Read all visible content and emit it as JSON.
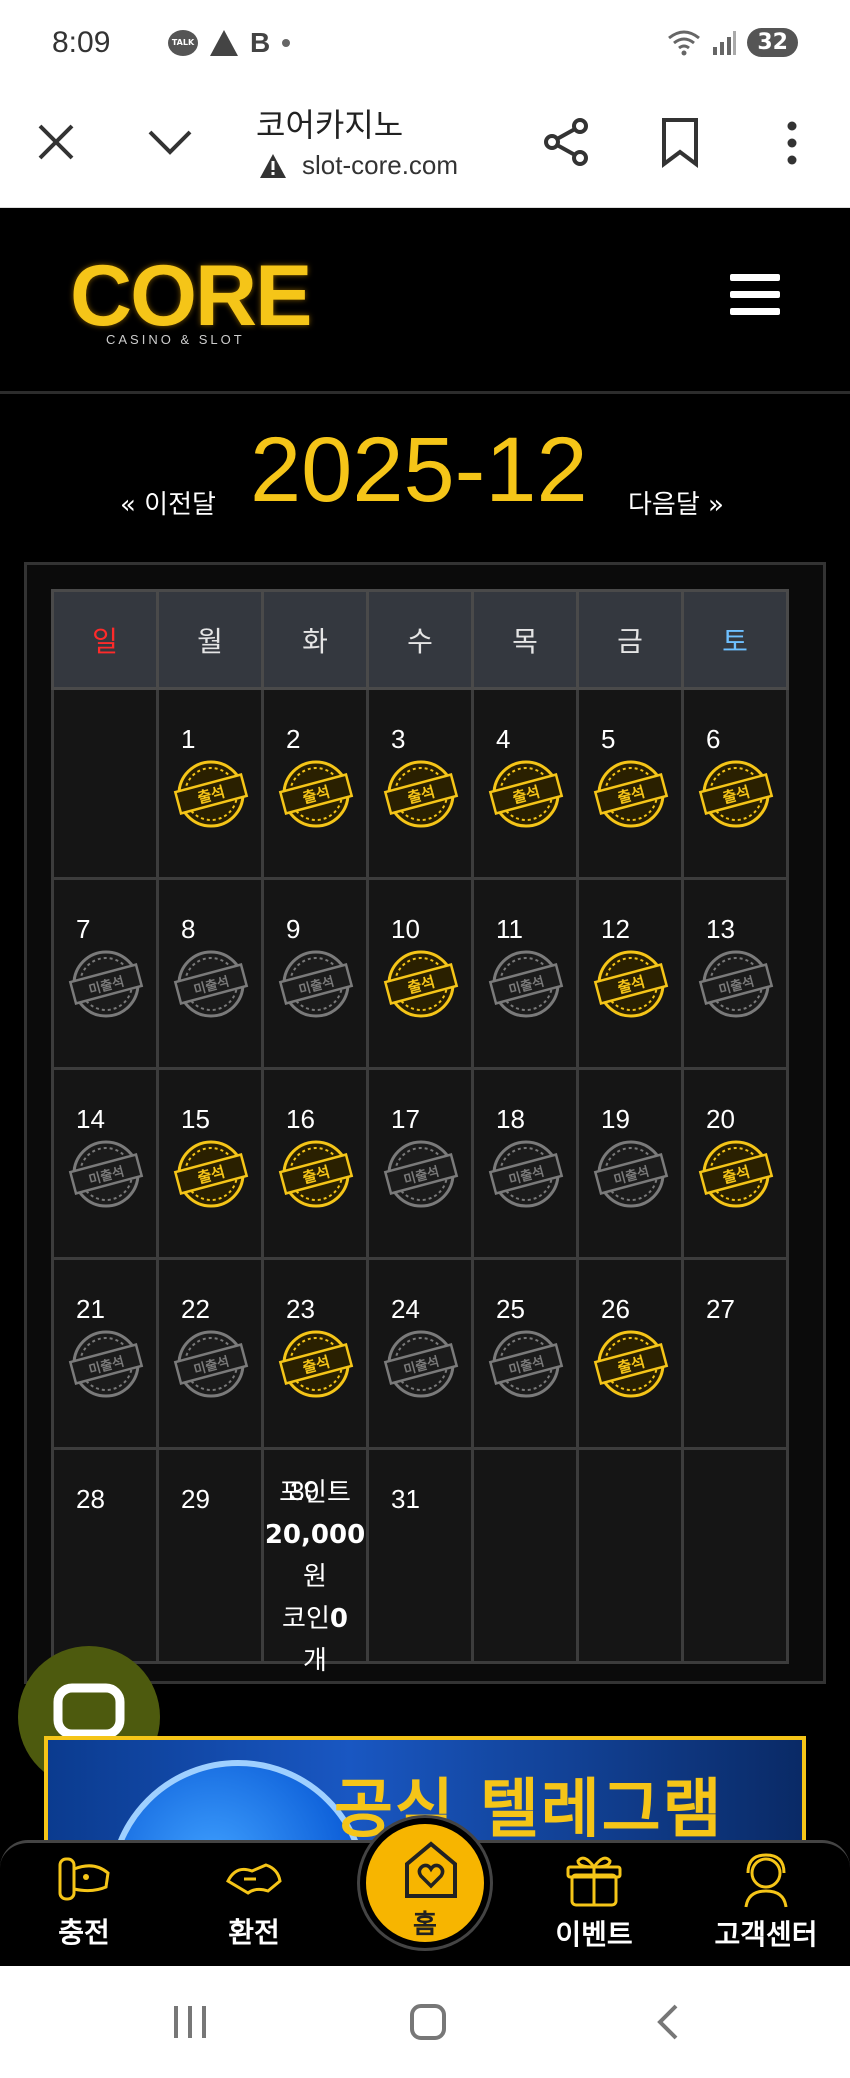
{
  "status_bar": {
    "time": "8:09",
    "battery": "32",
    "talk_label": "TALK",
    "b_label": "B"
  },
  "browser": {
    "title": "코어카지노",
    "url": "slot-core.com"
  },
  "site": {
    "logo_main": "CORE",
    "logo_sub": "CASINO & SLOT"
  },
  "month_nav": {
    "prev": "« 이전달",
    "month": "2025-12",
    "next": "다음달 »"
  },
  "calendar": {
    "weekdays": [
      "일",
      "월",
      "화",
      "수",
      "목",
      "금",
      "토"
    ],
    "stamp_attended": "출석",
    "stamp_absent": "미출석",
    "weeks": [
      [
        {
          "d": "",
          "s": ""
        },
        {
          "d": "1",
          "s": "att"
        },
        {
          "d": "2",
          "s": "att"
        },
        {
          "d": "3",
          "s": "att"
        },
        {
          "d": "4",
          "s": "att"
        },
        {
          "d": "5",
          "s": "att"
        },
        {
          "d": "6",
          "s": "att"
        }
      ],
      [
        {
          "d": "7",
          "s": "abs"
        },
        {
          "d": "8",
          "s": "abs"
        },
        {
          "d": "9",
          "s": "abs"
        },
        {
          "d": "10",
          "s": "att"
        },
        {
          "d": "11",
          "s": "abs"
        },
        {
          "d": "12",
          "s": "att"
        },
        {
          "d": "13",
          "s": "abs"
        }
      ],
      [
        {
          "d": "14",
          "s": "abs"
        },
        {
          "d": "15",
          "s": "att"
        },
        {
          "d": "16",
          "s": "att"
        },
        {
          "d": "17",
          "s": "abs"
        },
        {
          "d": "18",
          "s": "abs"
        },
        {
          "d": "19",
          "s": "abs"
        },
        {
          "d": "20",
          "s": "att"
        }
      ],
      [
        {
          "d": "21",
          "s": "abs"
        },
        {
          "d": "22",
          "s": "abs"
        },
        {
          "d": "23",
          "s": "att"
        },
        {
          "d": "24",
          "s": "abs"
        },
        {
          "d": "25",
          "s": "abs"
        },
        {
          "d": "26",
          "s": "att"
        },
        {
          "d": "27",
          "s": ""
        }
      ]
    ],
    "last_week": {
      "d28": "28",
      "d29": "29",
      "d30": "30",
      "d31": "31",
      "points_label": "포인트",
      "points_value": "20,000",
      "points_unit": "원",
      "coin_label": "코인",
      "coin_value": "0",
      "coin_unit": "개"
    }
  },
  "banner": {
    "text": "공식 텔레그램"
  },
  "bottom_nav": {
    "charge": "충전",
    "exchange": "환전",
    "home": "홈",
    "event": "이벤트",
    "support": "고객센터"
  }
}
